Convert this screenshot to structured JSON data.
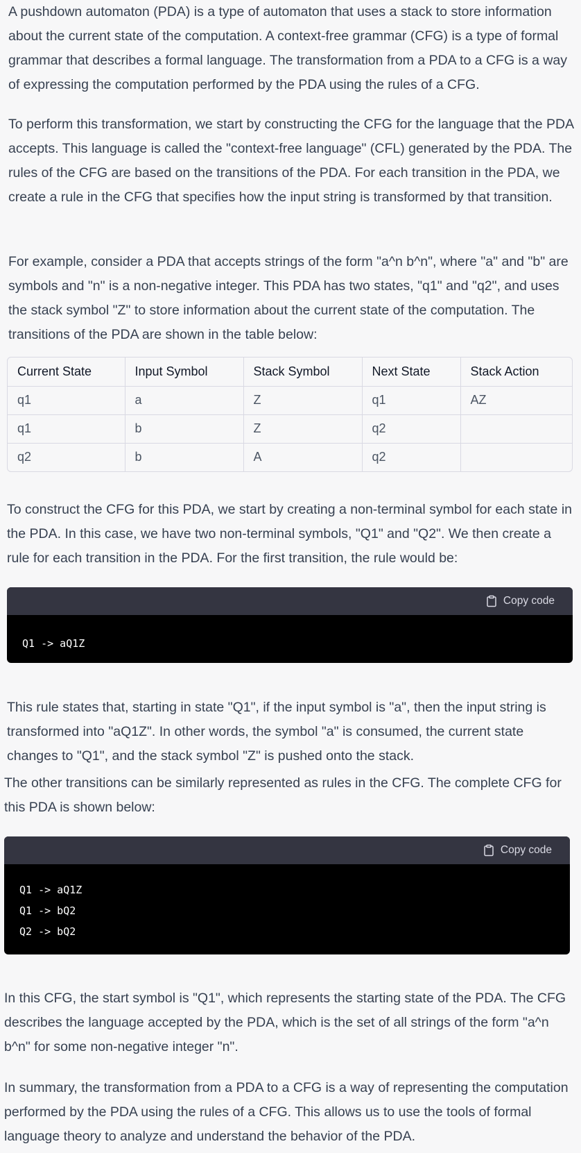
{
  "paragraphs": {
    "p1": "A pushdown automaton (PDA) is a type of automaton that uses a stack to store information about the current state of the computation. A context-free grammar (CFG) is a type of formal grammar that describes a formal language. The transformation from a PDA to a CFG is a way of expressing the computation performed by the PDA using the rules of a CFG.",
    "p2": "To perform this transformation, we start by constructing the CFG for the language that the PDA accepts. This language is called the \"context-free language\" (CFL) generated by the PDA. The rules of the CFG are based on the transitions of the PDA. For each transition in the PDA, we create a rule in the CFG that specifies how the input string is transformed by that transition.",
    "p3": "For example, consider a PDA that accepts strings of the form \"a^n b^n\", where \"a\" and \"b\" are symbols and \"n\" is a non-negative integer. This PDA has two states, \"q1\" and \"q2\", and uses the stack symbol \"Z\" to store information about the current state of the computation. The transitions of the PDA are shown in the table below:",
    "p4": "To construct the CFG for this PDA, we start by creating a non-terminal symbol for each state in the PDA. In this case, we have two non-terminal symbols, \"Q1\" and \"Q2\". We then create a rule for each transition in the PDA. For the first transition, the rule would be:",
    "p5": "This rule states that, starting in state \"Q1\", if the input symbol is \"a\", then the input string is transformed into \"aQ1Z\". In other words, the symbol \"a\" is consumed, the current state changes to \"Q1\", and the stack symbol \"Z\" is pushed onto the stack.",
    "p6": "The other transitions can be similarly represented as rules in the CFG. The complete CFG for this PDA is shown below:",
    "p7": "In this CFG, the start symbol is \"Q1\", which represents the starting state of the PDA. The CFG describes the language accepted by the PDA, which is the set of all strings of the form \"a^n b^n\" for some non-negative integer \"n\".",
    "p8": "In summary, the transformation from a PDA to a CFG is a way of representing the computation performed by the PDA using the rules of a CFG. This allows us to use the tools of formal language theory to analyze and understand the behavior of the PDA."
  },
  "table": {
    "headers": [
      "Current State",
      "Input Symbol",
      "Stack Symbol",
      "Next State",
      "Stack Action"
    ],
    "rows": [
      [
        "q1",
        "a",
        "Z",
        "q1",
        "AZ"
      ],
      [
        "q1",
        "b",
        "Z",
        "q2",
        ""
      ],
      [
        "q2",
        "b",
        "A",
        "q2",
        ""
      ]
    ]
  },
  "code1": {
    "copy_label": "Copy code",
    "code": "Q1 -> aQ1Z"
  },
  "code2": {
    "copy_label": "Copy code",
    "code": "Q1 -> aQ1Z\nQ1 -> bQ2\nQ2 -> bQ2"
  },
  "colors": {
    "background": "#f7f7f8",
    "text": "#374151",
    "code_header": "#343541",
    "code_body": "#000000"
  }
}
